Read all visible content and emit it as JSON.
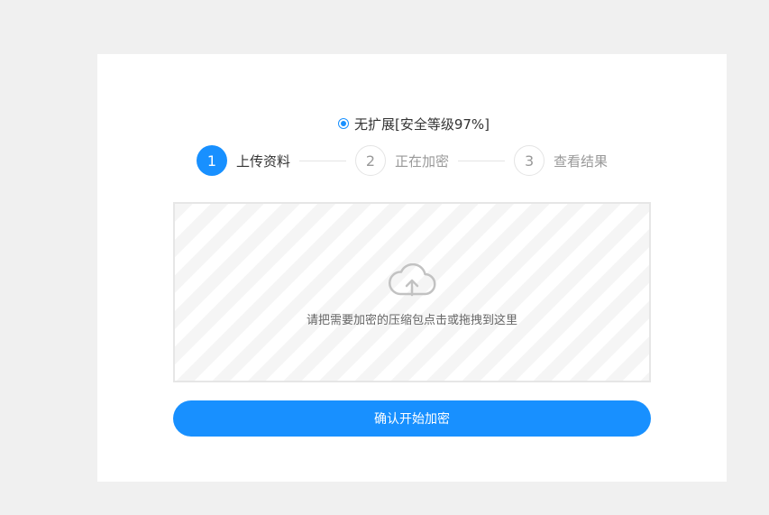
{
  "encryption_option": {
    "label": "无扩展[安全等级97%]",
    "selected": true
  },
  "steps": [
    {
      "number": "1",
      "title": "上传资料",
      "active": true
    },
    {
      "number": "2",
      "title": "正在加密",
      "active": false
    },
    {
      "number": "3",
      "title": "查看结果",
      "active": false
    }
  ],
  "dropzone": {
    "icon": "cloud-upload-icon",
    "text": "请把需要加密的压缩包点击或拖拽到这里"
  },
  "confirm_button": {
    "label": "确认开始加密"
  },
  "colors": {
    "accent": "#1890ff",
    "background": "#f0f0f0",
    "card": "#ffffff"
  }
}
